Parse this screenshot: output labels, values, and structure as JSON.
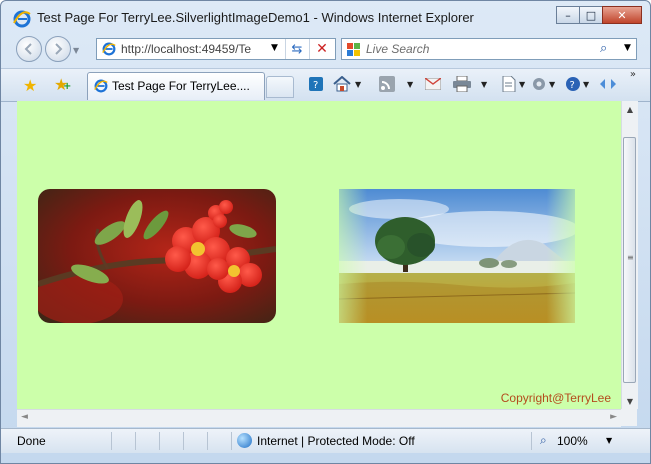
{
  "window": {
    "title": "Test Page For TerryLee.SilverlightImageDemo1 - Windows Internet Explorer",
    "controls": {
      "minimize": "–",
      "maximize": "□",
      "close": "✕"
    }
  },
  "address": {
    "url": "http://localhost:49459/Te",
    "dropdown": "▼",
    "refresh": "⇆",
    "stop": "✕"
  },
  "search": {
    "placeholder": "Live Search",
    "go": "⌕",
    "dropdown": "▼"
  },
  "tab": {
    "label": "Test Page For TerryLee...."
  },
  "toolbar": {
    "favorites_icon": "star-icon",
    "add_favorites_icon": "add-favorites-icon",
    "overflow": "»"
  },
  "content": {
    "background": "#ccffaa",
    "copyright": "Copyright@TerryLee"
  },
  "scroll": {
    "up": "▲",
    "down": "▼",
    "left": "◄",
    "right": "►",
    "grip": "≡"
  },
  "status": {
    "text": "Done",
    "zone": "Internet | Protected Mode: Off",
    "zoom": "100%",
    "zoom_dropdown": "▼"
  }
}
